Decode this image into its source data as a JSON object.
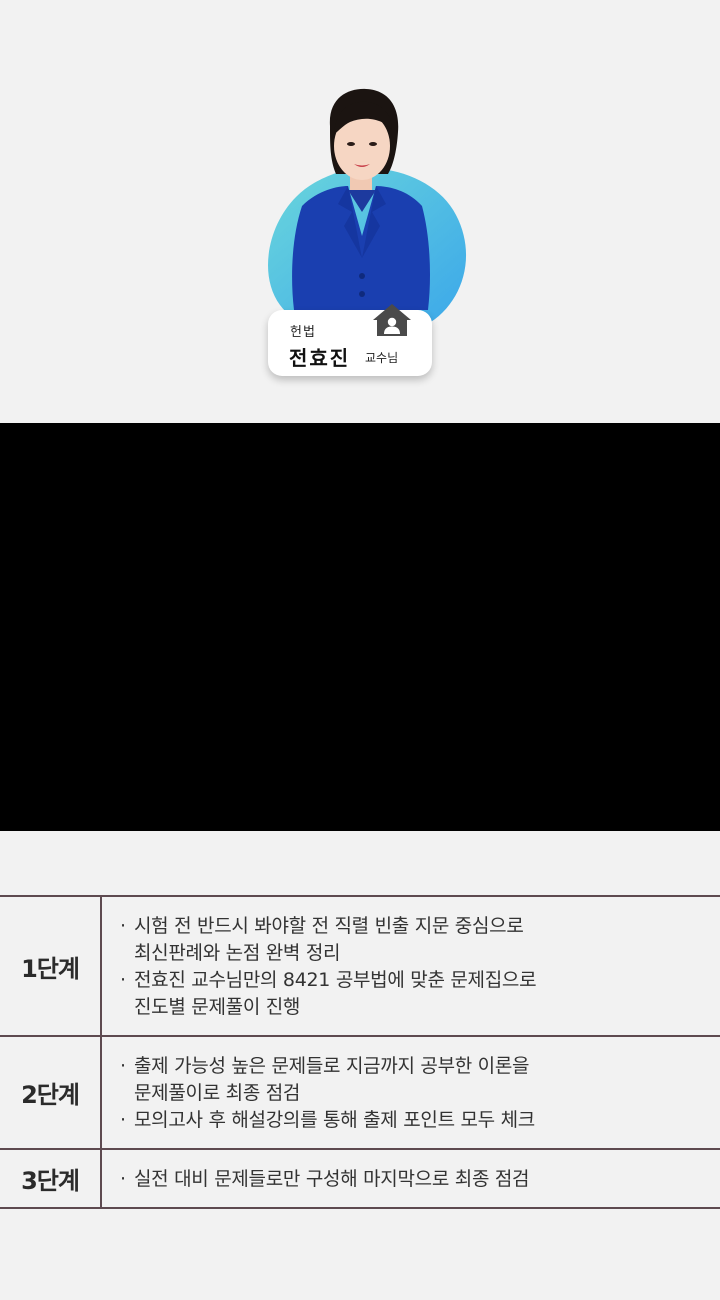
{
  "professor": {
    "subject": "헌법",
    "name": "전효진",
    "title": "교수님"
  },
  "icons": {
    "home": "home-user-icon"
  },
  "colors": {
    "blob_top": "#6ad6dc",
    "blob_bottom": "#3aa6ea",
    "jacket": "#1a3fb0",
    "divider": "#5e4a50"
  },
  "steps": [
    {
      "label": "1단계",
      "items": [
        "시험 전 반드시 봐야할 전 직렬 빈출 지문 중심으로\n최신판례와 논점 완벽 정리",
        "전효진 교수님만의 8421 공부법에 맞춘 문제집으로\n진도별 문제풀이 진행"
      ]
    },
    {
      "label": "2단계",
      "items": [
        "출제 가능성 높은 문제들로 지금까지 공부한 이론을\n문제풀이로 최종 점검",
        "모의고사 후 해설강의를 통해 출제 포인트 모두 체크"
      ]
    },
    {
      "label": "3단계",
      "items": [
        "실전 대비 문제들로만 구성해 마지막으로 최종 점검"
      ]
    }
  ]
}
